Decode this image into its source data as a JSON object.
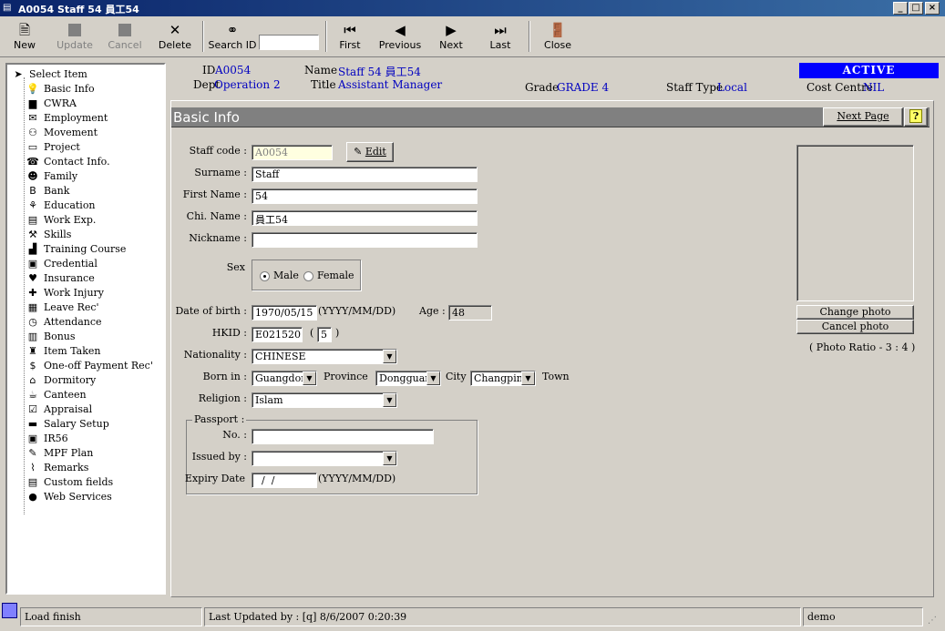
{
  "window": {
    "title": "A0054 Staff 54 員工54",
    "app_icon": "app-icon",
    "min": "_",
    "max": "□",
    "close": "×"
  },
  "toolbar": {
    "new": "New",
    "update": "Update",
    "cancel": "Cancel",
    "delete": "Delete",
    "search_id": "Search ID",
    "search_value": "",
    "first": "First",
    "previous": "Previous",
    "next": "Next",
    "last": "Last",
    "close": "Close"
  },
  "tree": {
    "root": "Select Item",
    "items": [
      {
        "label": "Basic Info",
        "icon": "bulb-icon",
        "glyph": "💡"
      },
      {
        "label": "CWRA",
        "icon": "book-icon",
        "glyph": "▆"
      },
      {
        "label": "Employment",
        "icon": "envelope-icon",
        "glyph": "✉"
      },
      {
        "label": "Movement",
        "icon": "people-icon",
        "glyph": "⚇"
      },
      {
        "label": "Project",
        "icon": "folder-icon",
        "glyph": "▭"
      },
      {
        "label": "Contact Info.",
        "icon": "phone-icon",
        "glyph": "☎"
      },
      {
        "label": "Family",
        "icon": "family-icon",
        "glyph": "☻"
      },
      {
        "label": "Bank",
        "icon": "bank-icon",
        "glyph": "B"
      },
      {
        "label": "Education",
        "icon": "education-icon",
        "glyph": "⚘"
      },
      {
        "label": "Work Exp.",
        "icon": "document-icon",
        "glyph": "▤"
      },
      {
        "label": "Skills",
        "icon": "wrench-icon",
        "glyph": "⚒"
      },
      {
        "label": "Training Course",
        "icon": "training-icon",
        "glyph": "▟"
      },
      {
        "label": "Credential",
        "icon": "credential-icon",
        "glyph": "▣"
      },
      {
        "label": "Insurance",
        "icon": "heart-icon",
        "glyph": "♥"
      },
      {
        "label": "Work Injury",
        "icon": "cross-icon",
        "glyph": "✚"
      },
      {
        "label": "Leave Rec'",
        "icon": "calendar-icon",
        "glyph": "▦"
      },
      {
        "label": "Attendance",
        "icon": "clock-icon",
        "glyph": "◷"
      },
      {
        "label": "Bonus",
        "icon": "bonus-icon",
        "glyph": "▥"
      },
      {
        "label": "Item Taken",
        "icon": "item-icon",
        "glyph": "♜"
      },
      {
        "label": "One-off Payment Rec'",
        "icon": "dollar-icon",
        "glyph": "$"
      },
      {
        "label": "Dormitory",
        "icon": "house-icon",
        "glyph": "⌂"
      },
      {
        "label": "Canteen",
        "icon": "canteen-icon",
        "glyph": "☕"
      },
      {
        "label": "Appraisal",
        "icon": "checkbox-icon",
        "glyph": "☑"
      },
      {
        "label": "Salary Setup",
        "icon": "salary-icon",
        "glyph": "▬"
      },
      {
        "label": "IR56",
        "icon": "floppy-icon",
        "glyph": "▣"
      },
      {
        "label": "MPF Plan",
        "icon": "mpf-icon",
        "glyph": "✎"
      },
      {
        "label": "Remarks",
        "icon": "paperclip-icon",
        "glyph": "⌇"
      },
      {
        "label": "Custom fields",
        "icon": "custom-icon",
        "glyph": "▤"
      },
      {
        "label": "Web Services",
        "icon": "globe-icon",
        "glyph": "●"
      }
    ]
  },
  "header": {
    "id_label": "ID",
    "id_value": "A0054",
    "name_label": "Name",
    "name_value": "Staff 54 員工54",
    "dept_label": "Dept",
    "dept_value": "Operation 2",
    "title_label": "Title",
    "title_value": "Assistant Manager",
    "grade_label": "Grade",
    "grade_value": "GRADE 4",
    "stafftype_label": "Staff Type",
    "stafftype_value": "Local",
    "costcentre_label": "Cost Centre",
    "costcentre_value": "NIL",
    "status": "ACTIVE",
    "status_color": "#0000ff"
  },
  "section": {
    "title": "Basic Info",
    "next_page": "Next Page",
    "help": "?"
  },
  "form": {
    "staff_code_label": "Staff code :",
    "staff_code": "A0054",
    "edit": "Edit",
    "surname_label": "Surname :",
    "surname": "Staff",
    "first_name_label": "First Name :",
    "first_name": "54",
    "chi_name_label": "Chi. Name :",
    "chi_name": "員工54",
    "nickname_label": "Nickname :",
    "nickname": "",
    "sex_label": "Sex",
    "male": "Male",
    "female": "Female",
    "dob_label": "Date of birth :",
    "dob": "1970/05/15",
    "dob_fmt": "(YYYY/MM/DD)",
    "age_label": "Age :",
    "age": "48",
    "hkid_label": "HKID :",
    "hkid": "E021520",
    "hkid_open": "(",
    "hkid_check": "5",
    "hkid_close": ")",
    "nationality_label": "Nationality :",
    "nationality": "CHINESE",
    "born_in_label": "Born in :",
    "born_in": "Guangdong",
    "province_label": "Province",
    "city_value": "Dongguan",
    "city_label": "City",
    "town_value": "Changping",
    "town_label": "Town",
    "religion_label": "Religion :",
    "religion": "Islam",
    "passport_label": "Passport :",
    "passport_no_label": "No. :",
    "passport_no": "",
    "issued_by_label": "Issued by :",
    "issued_by": "",
    "expiry_label": "Expiry Date",
    "expiry": "  /  /",
    "expiry_fmt": "(YYYY/MM/DD)",
    "change_photo": "Change photo",
    "cancel_photo": "Cancel photo",
    "photo_ratio": "( Photo Ratio - 3 : 4 )"
  },
  "status": {
    "message": "Load finish",
    "last_updated": "Last Updated by : [q]  8/6/2007 0:20:39",
    "user": "demo"
  }
}
